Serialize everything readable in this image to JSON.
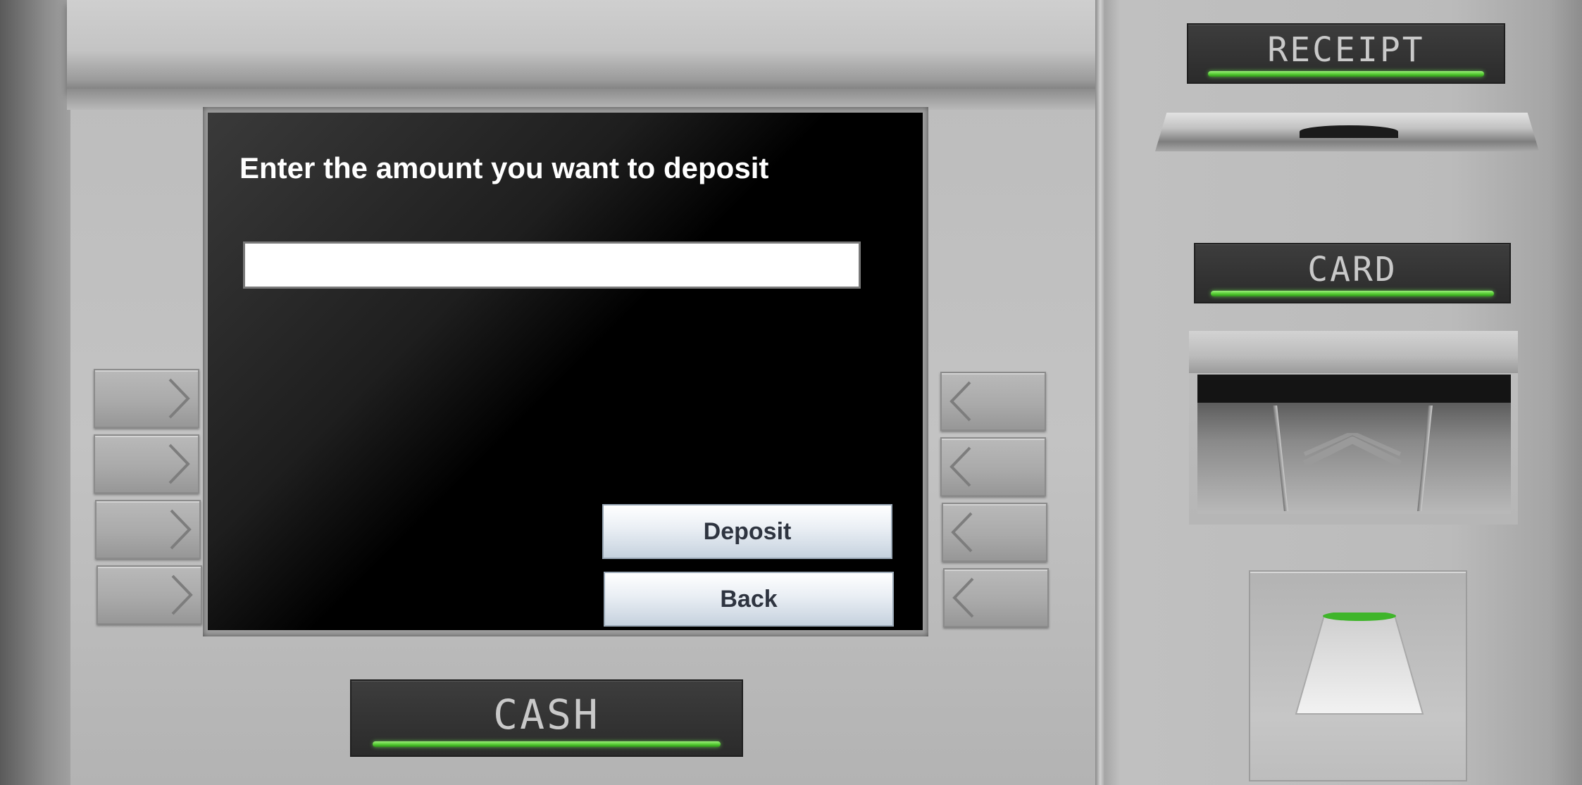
{
  "screen": {
    "prompt": "Enter the amount you want to deposit",
    "amount_input": {
      "value": "",
      "placeholder": ""
    },
    "buttons": {
      "deposit": "Deposit",
      "back": "Back"
    }
  },
  "labels": {
    "receipt": "RECEIPT",
    "card": "CARD",
    "cash": "CASH"
  },
  "icons": {
    "left_keys": "chevron-right-icon",
    "right_keys": "chevron-left-icon",
    "card_slot": "chevron-up-icon"
  },
  "colors": {
    "indicator_green": "#4fc72d",
    "screen_bg": "#000000",
    "screen_text": "#ffffff",
    "label_plate": "#333333",
    "label_text": "#c9c9c9"
  }
}
